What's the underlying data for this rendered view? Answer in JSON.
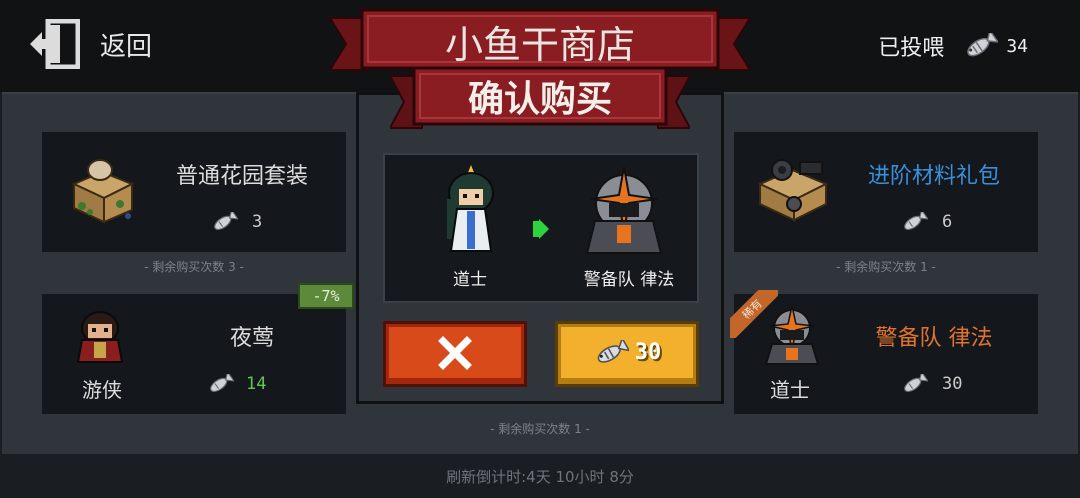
{
  "header": {
    "back_label": "返回",
    "fed_label": "已投喂",
    "fed_count": "34"
  },
  "shop": {
    "title": "小鱼干商店",
    "subtitle": "确认购买"
  },
  "cards": {
    "garden": {
      "name": "普通花园套装",
      "price": "3",
      "remaining": "- 剩余购买次数 3 -"
    },
    "material": {
      "name": "进阶材料礼包",
      "price": "6",
      "remaining": "- 剩余购买次数 1 -"
    },
    "nightingale": {
      "name": "夜莺",
      "class_label": "游侠",
      "price": "14",
      "discount": "-7%"
    },
    "guard": {
      "name": "警备队 律法",
      "class_label": "道士",
      "price": "30",
      "tag": "稀有"
    }
  },
  "center_remaining": "- 剩余购买次数 1 -",
  "modal": {
    "from_label": "道士",
    "to_label": "警备队 律法",
    "price": "30"
  },
  "footer": {
    "refresh_text": "刷新倒计时:4天 10小时 8分"
  },
  "colors": {
    "accent_blue": "#3b8fd9",
    "accent_orange": "#e0732e",
    "price_green": "#5fc94d",
    "cancel_red": "#d94a1a",
    "buy_yellow": "#f2b02c",
    "ribbon_red": "#8a1d21"
  },
  "icons": [
    "door-exit-icon",
    "fish-icon",
    "close-icon",
    "arrow-right-icon"
  ]
}
